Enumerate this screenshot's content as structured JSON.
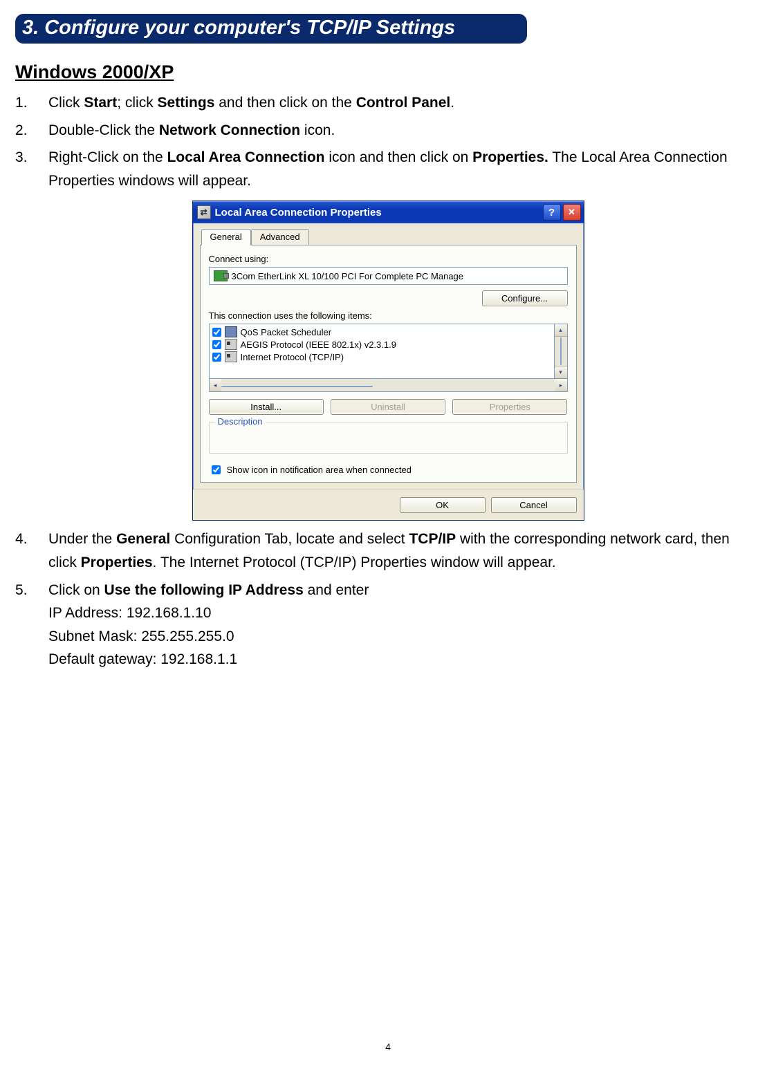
{
  "section_heading": "3. Configure your computer's TCP/IP Settings",
  "sub_heading": "Windows 2000/XP",
  "steps": {
    "s1": {
      "pre": "Click ",
      "b1": "Start",
      "mid1": "; click ",
      "b2": "Settings",
      "mid2": " and then click on the ",
      "b3": "Control Panel",
      "post": "."
    },
    "s2": {
      "pre": "Double-Click the ",
      "b1": "Network Connection",
      "post": " icon."
    },
    "s3": {
      "pre": "Right-Click on the ",
      "b1": "Local Area Connection",
      "mid1": " icon and then click on ",
      "b2": "Properties.",
      "post": " The Local Area Connection Properties windows will appear."
    },
    "s4": {
      "pre": "Under the ",
      "b1": "General",
      "mid1": " Configuration Tab, locate and select ",
      "b2": "TCP/IP",
      "mid2": " with the corresponding network card, then click ",
      "b3": "Properties",
      "post": ". The Internet Protocol (TCP/IP) Properties window will appear."
    },
    "s5": {
      "pre": "Click on ",
      "b1": "Use the following IP Address",
      "post": " and enter",
      "lines": [
        "IP Address: 192.168.1.10",
        "Subnet Mask: 255.255.255.0",
        "Default gateway: 192.168.1.1"
      ]
    }
  },
  "xp": {
    "title": "Local Area Connection Properties",
    "tabs": {
      "general": "General",
      "advanced": "Advanced"
    },
    "connect_using_label": "Connect using:",
    "adapter_name": "3Com EtherLink XL 10/100 PCI For Complete PC Manage",
    "configure_btn": "Configure...",
    "items_label": "This connection uses the following items:",
    "items": [
      "QoS Packet Scheduler",
      "AEGIS Protocol (IEEE 802.1x) v2.3.1.9",
      "Internet Protocol (TCP/IP)"
    ],
    "install_btn": "Install...",
    "uninstall_btn": "Uninstall",
    "properties_btn": "Properties",
    "description_label": "Description",
    "show_icon_label": "Show icon in notification area when connected",
    "ok_btn": "OK",
    "cancel_btn": "Cancel",
    "help_glyph": "?",
    "close_glyph": "✕"
  },
  "page_number": "4"
}
